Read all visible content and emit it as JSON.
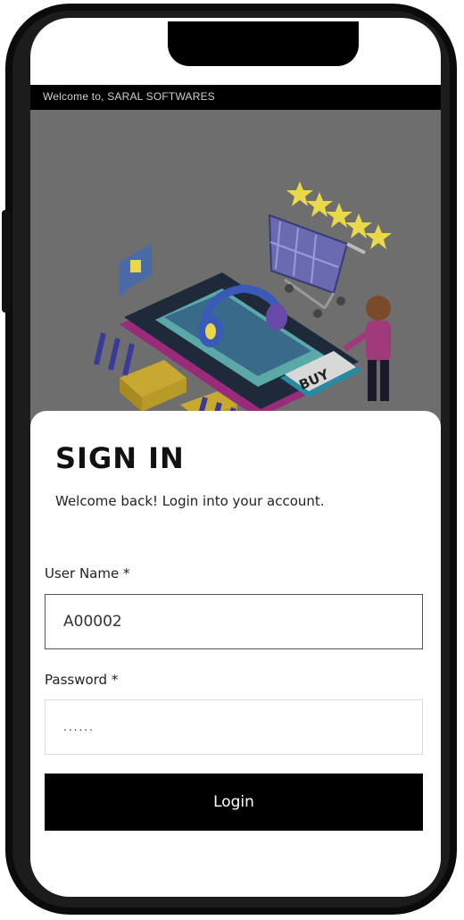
{
  "header": {
    "welcome_text": "Welcome to, SARAL SOFTWARES"
  },
  "hero": {
    "alt": "Online shopping illustration",
    "badge_text": "BUY"
  },
  "login": {
    "title": "SIGN IN",
    "subtitle": "Welcome back! Login into your account.",
    "username_label": "User Name *",
    "username_value": "A00002",
    "password_label": "Password *",
    "password_value": "......",
    "login_label": "Login"
  }
}
